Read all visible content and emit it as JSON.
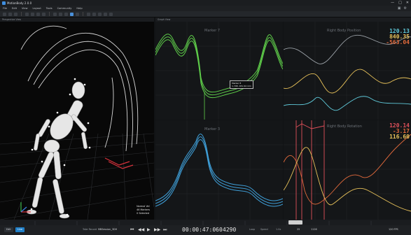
{
  "window": {
    "title": "MotionBody 2.0.0",
    "controls": [
      "—",
      "□",
      "✕"
    ]
  },
  "menu": [
    "File",
    "Edit",
    "View",
    "Layout",
    "Tools",
    "Community",
    "Help"
  ],
  "panels": {
    "viewport_title": "Perspective View",
    "graph_title": "Graph View"
  },
  "viewport": {
    "status": [
      "Normal Vel",
      "46 Markers",
      "0 Selected"
    ]
  },
  "graphs": {
    "top_left": {
      "title": "Marker 7"
    },
    "bottom_left": {
      "title": "Marker 3"
    },
    "top_right": {
      "title": "Right Body Position",
      "readouts": [
        "120.13",
        "840.35",
        "-563.04"
      ],
      "colors": [
        "#5fc8d8",
        "#e8c25a",
        "#e26a3c"
      ]
    },
    "bottom_right": {
      "title": "Right Body Rotation",
      "readouts": [
        "120.14",
        "-3.17",
        "116.60"
      ],
      "colors": [
        "#e0505a",
        "#e26a3c",
        "#e8c25a"
      ]
    }
  },
  "tooltip": {
    "title": "Marker 8",
    "value": "1.748, 181.94 mm"
  },
  "transport": {
    "take_label": "Take Record",
    "take_name": "MBSession_3DH",
    "time": "00:00:47:060",
    "frame": "4290",
    "loop_label": "Loop",
    "speed_label": "Speed",
    "range_label": "1.0x",
    "start_frame": "25",
    "end_frame": "1126",
    "fps": "120 FPS",
    "chip_left": "Edit",
    "chip_left2": "Live"
  },
  "accent": "#4a90d9"
}
